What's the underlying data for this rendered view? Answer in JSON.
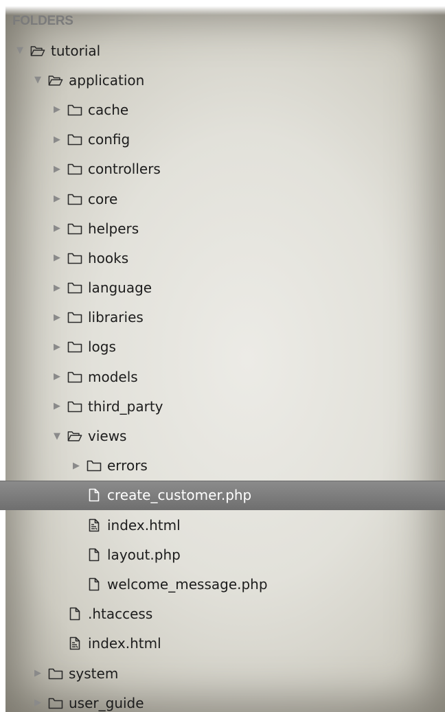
{
  "sidebar": {
    "header": "FOLDERS"
  },
  "tree": [
    {
      "label": "tutorial",
      "kind": "folder",
      "state": "expanded",
      "depth": 0,
      "icon": "folder-open-icon"
    },
    {
      "label": "application",
      "kind": "folder",
      "state": "expanded",
      "depth": 1,
      "icon": "folder-open-icon"
    },
    {
      "label": "cache",
      "kind": "folder",
      "state": "collapsed",
      "depth": 2,
      "icon": "folder-icon"
    },
    {
      "label": "config",
      "kind": "folder",
      "state": "collapsed",
      "depth": 2,
      "icon": "folder-icon"
    },
    {
      "label": "controllers",
      "kind": "folder",
      "state": "collapsed",
      "depth": 2,
      "icon": "folder-icon"
    },
    {
      "label": "core",
      "kind": "folder",
      "state": "collapsed",
      "depth": 2,
      "icon": "folder-icon"
    },
    {
      "label": "helpers",
      "kind": "folder",
      "state": "collapsed",
      "depth": 2,
      "icon": "folder-icon"
    },
    {
      "label": "hooks",
      "kind": "folder",
      "state": "collapsed",
      "depth": 2,
      "icon": "folder-icon"
    },
    {
      "label": "language",
      "kind": "folder",
      "state": "collapsed",
      "depth": 2,
      "icon": "folder-icon"
    },
    {
      "label": "libraries",
      "kind": "folder",
      "state": "collapsed",
      "depth": 2,
      "icon": "folder-icon"
    },
    {
      "label": "logs",
      "kind": "folder",
      "state": "collapsed",
      "depth": 2,
      "icon": "folder-icon"
    },
    {
      "label": "models",
      "kind": "folder",
      "state": "collapsed",
      "depth": 2,
      "icon": "folder-icon"
    },
    {
      "label": "third_party",
      "kind": "folder",
      "state": "collapsed",
      "depth": 2,
      "icon": "folder-icon"
    },
    {
      "label": "views",
      "kind": "folder",
      "state": "expanded",
      "depth": 2,
      "icon": "folder-open-icon"
    },
    {
      "label": "errors",
      "kind": "folder",
      "state": "collapsed",
      "depth": 3,
      "icon": "folder-icon"
    },
    {
      "label": "create_customer.php",
      "kind": "file",
      "depth": 3,
      "icon": "file-icon",
      "selected": true
    },
    {
      "label": "index.html",
      "kind": "file",
      "depth": 3,
      "icon": "markup-file-icon"
    },
    {
      "label": "layout.php",
      "kind": "file",
      "depth": 3,
      "icon": "file-icon"
    },
    {
      "label": "welcome_message.php",
      "kind": "file",
      "depth": 3,
      "icon": "file-icon"
    },
    {
      "label": ".htaccess",
      "kind": "file",
      "depth": 2,
      "icon": "file-icon"
    },
    {
      "label": "index.html",
      "kind": "file",
      "depth": 2,
      "icon": "markup-file-icon"
    },
    {
      "label": "system",
      "kind": "folder",
      "state": "collapsed",
      "depth": 1,
      "icon": "folder-icon"
    },
    {
      "label": "user_guide",
      "kind": "folder",
      "state": "collapsed",
      "depth": 1,
      "icon": "folder-icon"
    }
  ],
  "colors": {
    "selection": "#7d7d7d",
    "text": "#1c1c1c",
    "header": "#7b7b7b",
    "disclosure": "#8a8a8a"
  }
}
